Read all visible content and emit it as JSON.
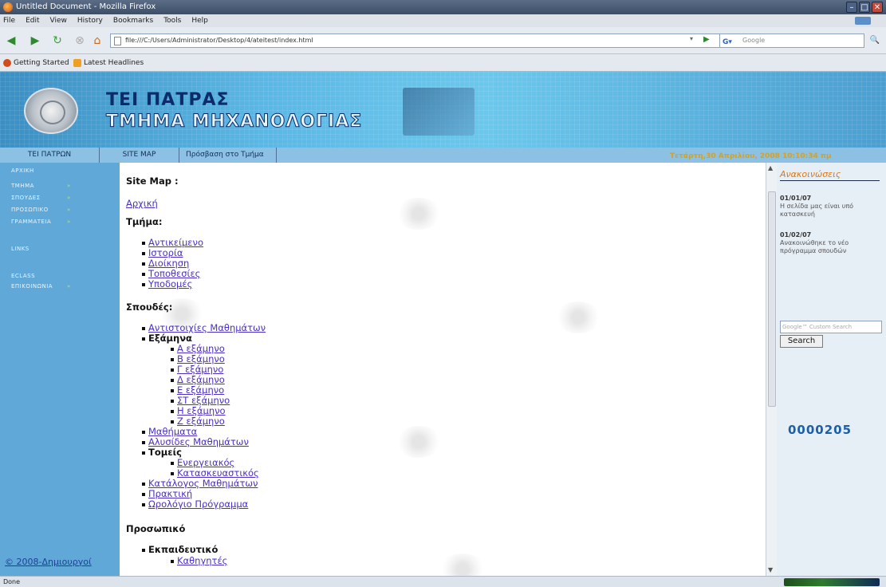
{
  "window": {
    "title": "Untitled Document - Mozilla Firefox"
  },
  "menu": [
    "File",
    "Edit",
    "View",
    "History",
    "Bookmarks",
    "Tools",
    "Help"
  ],
  "url": "file:///C:/Users/Administrator/Desktop/4/ateitest/index.html",
  "search_placeholder": "Google",
  "bookmarks": [
    "Getting Started",
    "Latest Headlines"
  ],
  "banner": {
    "title1": "TEI ΠΑΤΡΑΣ",
    "title2": "ΤΜΗΜΑ ΜΗΧΑΝΟΛΟΓΙΑΣ"
  },
  "topnav": [
    "TEI ΠΑΤΡΩΝ",
    "SITE MAP",
    "Πρόσβαση στο Τμήμα"
  ],
  "datetime": "Τετάρτη,30 Απριλίου, 2008 10:10:34 πμ",
  "sidebar": {
    "items": [
      "ΑΡΧΙΚΗ",
      "ΤΜΗΜΑ",
      "ΣΠΟΥΔΕΣ",
      "ΠΡΟΣΩΠΙΚΟ",
      "ΓΡΑΜΜΑΤΕΙΑ",
      "LINKS",
      "ECLASS",
      "ΕΠΙΚΟΙΝΩΝΙΑ"
    ],
    "arrow": "»",
    "footer": "© 2008-Δημιουργοί"
  },
  "main": {
    "heading": "Site Map :",
    "home_link": "Αρχική",
    "section1": "Τμήμα:",
    "section1_items": [
      "Αντικείμενο",
      "Ιστορία",
      "Διοίκηση",
      "Τοποθεσίες",
      "Υποδομές"
    ],
    "section2": "Σπουδές:",
    "studies_item1": "Αντιστοιχίες Μαθημάτων",
    "semesters_label": "Εξάμηνα",
    "semesters": [
      "Α εξάμηνο",
      "Β εξάμηνο",
      "Γ εξάμηνο",
      "Δ εξάμηνο",
      "Ε εξάμηνο",
      "ΣΤ εξάμηνο",
      "Η εξάμηνο",
      "Ζ εξάμηνο"
    ],
    "studies_item2": "Μαθήματα",
    "studies_item3": "Αλυσίδες Μαθημάτων",
    "departments_label": "Τομείς",
    "departments": [
      "Ενεργειακός",
      "Κατασκευαστικός"
    ],
    "studies_item4": "Κατάλογος Μαθημάτων",
    "studies_item5": "Πρακτική",
    "studies_item6": "Ωρολόγιο Πρόγραμμα",
    "section3": "Προσωπικό",
    "staff_label": "Εκπαιδευτικό",
    "staff_item1": "Καθηγητές"
  },
  "right": {
    "title": "Ανακοινώσεις",
    "news": [
      {
        "date": "01/01/07",
        "text": "Η σελίδα μας είναι υπό κατασκευή"
      },
      {
        "date": "01/02/07",
        "text": "Ανακοινώθηκε το νέο πρόγραμμα σπουδών"
      }
    ],
    "search_placeholder": "Google™ Custom Search",
    "search_button": "Search",
    "counter": "0000205"
  },
  "status": "Done"
}
